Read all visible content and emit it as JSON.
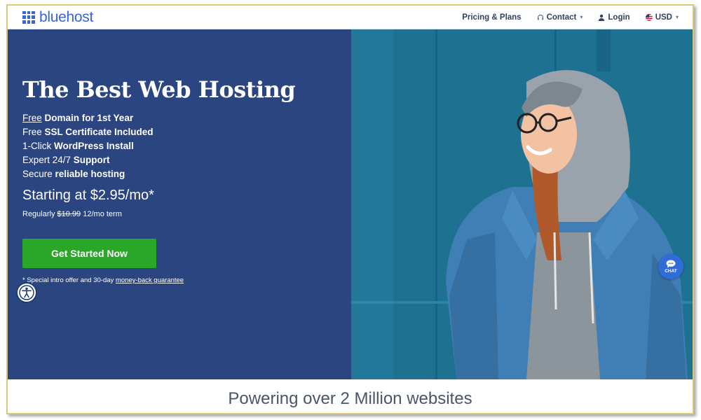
{
  "brand": {
    "name": "bluehost",
    "accent_color": "#3965d6"
  },
  "nav": {
    "pricing": "Pricing & Plans",
    "contact": "Contact",
    "login": "Login",
    "currency": "USD"
  },
  "hero": {
    "headline": "The Best Web Hosting",
    "features": [
      {
        "pre": "",
        "under": "Free",
        "bold": "Domain for 1st Year"
      },
      {
        "pre": "Free ",
        "under": "",
        "bold": "SSL Certificate Included"
      },
      {
        "pre": "1-Click ",
        "under": "",
        "bold": "WordPress Install"
      },
      {
        "pre": "Expert 24/7 ",
        "under": "",
        "bold": "Support"
      },
      {
        "pre": "Secure ",
        "under": "",
        "bold": "reliable hosting"
      }
    ],
    "price": "Starting at $2.95/mo*",
    "regular_prefix": "Regularly ",
    "regular_old": "$10.99",
    "regular_suffix": " 12/mo term",
    "cta": "Get Started Now",
    "disclaimer_prefix": "* Special intro offer and 30-day ",
    "disclaimer_link": "money-back guarantee",
    "left_bg": "#2b4580",
    "cta_color": "#2aa729"
  },
  "chat": {
    "label": "CHAT"
  },
  "bottom": {
    "text": "Powering over 2 Million websites"
  }
}
